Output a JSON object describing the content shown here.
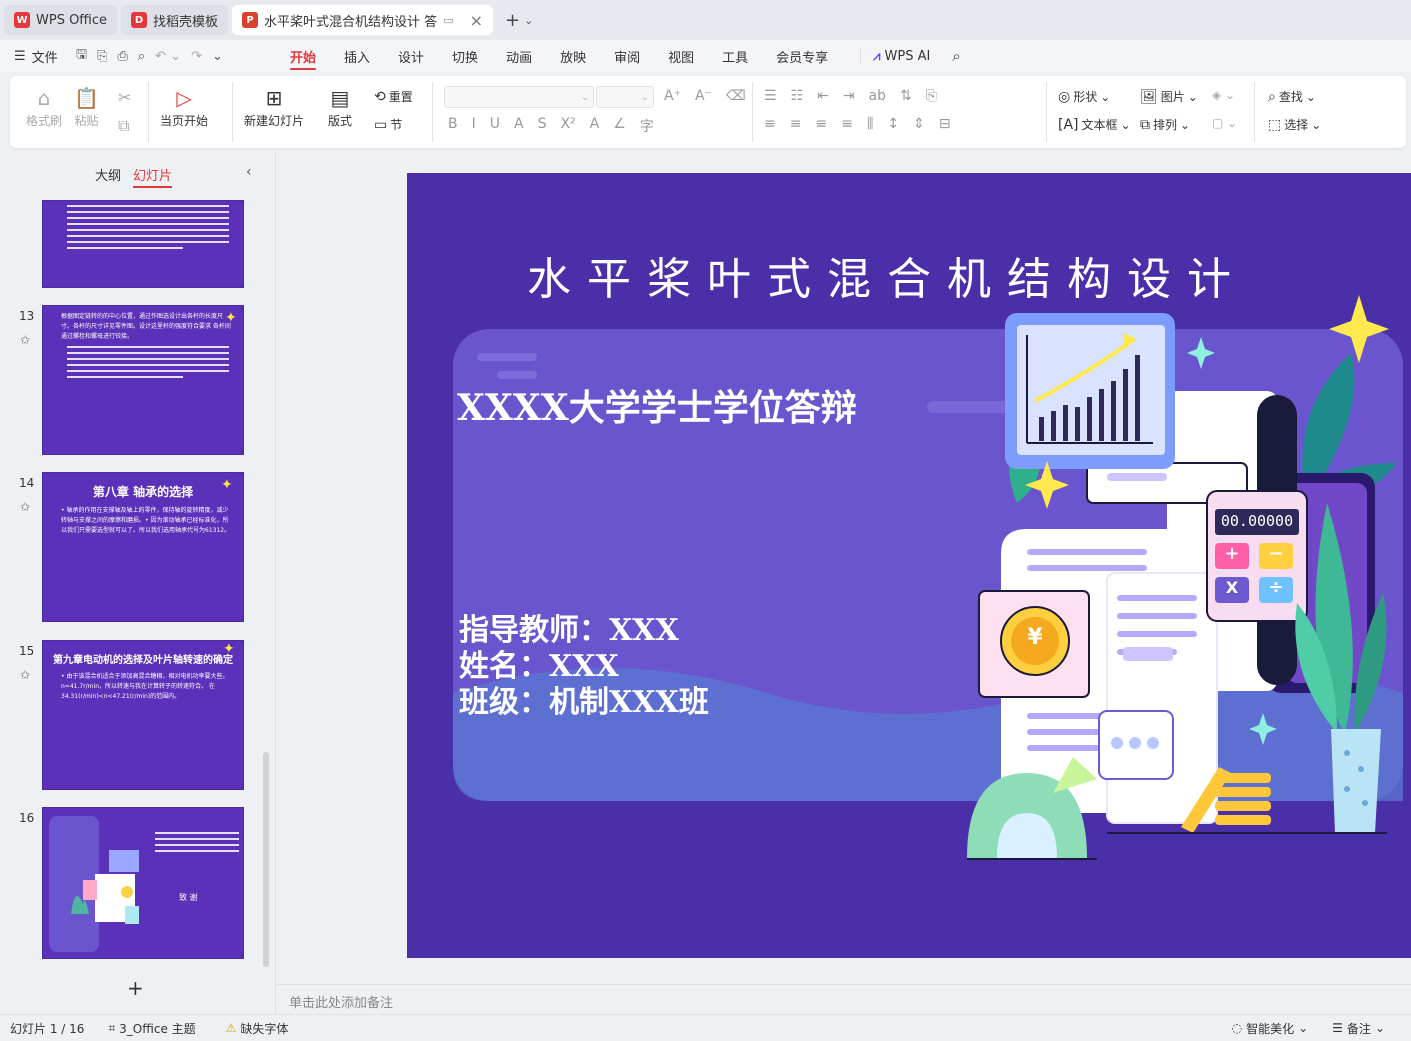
{
  "tabs": [
    {
      "label": "WPS Office",
      "logo": "W",
      "logo_color": "#e5383b",
      "active": false
    },
    {
      "label": "找稻壳模板",
      "logo": "D",
      "logo_color": "#e5383b",
      "active": false
    },
    {
      "label": "水平桨叶式混合机结构设计 答",
      "logo": "P",
      "logo_color": "#d9402e",
      "active": true
    }
  ],
  "menu": {
    "file": "文件",
    "items": [
      "开始",
      "插入",
      "设计",
      "切换",
      "动画",
      "放映",
      "审阅",
      "视图",
      "工具",
      "会员专享"
    ],
    "active": "开始",
    "ai": "WPS AI"
  },
  "ribbon": {
    "format_painter": "格式刷",
    "paste": "粘贴",
    "play_from_current": "当页开始",
    "new_slide": "新建幻灯片",
    "layout": "版式",
    "reset": "重置",
    "section": "节",
    "shape": "形状",
    "picture": "图片",
    "textbox": "文本框",
    "arrange": "排列",
    "find": "查找",
    "select": "选择"
  },
  "left_panel": {
    "tab_outline": "大纲",
    "tab_slides": "幻灯片",
    "slides": [
      {
        "num": "13",
        "title": "",
        "body": "根据图定链转的的中心位置，通过作图选设计出各杆的长度尺寸。各杆的尺寸详见零件图。设计这里杆的强度符合要求 各杆间通过螺栓和螺母进行铰接。"
      },
      {
        "num": "14",
        "title": "第八章  轴承的选择",
        "body": "• 轴承的作用在支撑轴及轴上的零件，保持轴的旋转精度，减少转轴与支撑之间的摩擦和磨损。• 因为滚动轴承已经标准化，所以我们只需要选型就可以了。所以我们选用轴承代号为61312。"
      },
      {
        "num": "15",
        "title": "第九章电动机的选择及叶片轴转速的确定",
        "body": "• 由于该混合机适合于添加高混合糖稠，相对电机功率要大些。 n=41.7r/min，所以转速与我在计算转子的转速符合。 在34.31(r/min)<n<47.21(r/min)的范围内。"
      },
      {
        "num": "16",
        "title": "致 谢",
        "body": ""
      }
    ]
  },
  "slide": {
    "title": "水平桨叶式混合机结构设计",
    "subtitle": "XXXX大学学士学位答辩",
    "advisor": "指导教师：XXX",
    "name": "姓名：XXX",
    "class": "班级：机制XXX班",
    "calculator_display": "00.00000",
    "coin_symbol": "¥"
  },
  "notes_placeholder": "单击此处添加备注",
  "status": {
    "slide_counter": "幻灯片 1 / 16",
    "theme": "3_Office 主题",
    "missing_font": "缺失字体",
    "smart_beautify": "智能美化",
    "notes": "备注"
  },
  "colors": {
    "accent": "#e5383b",
    "slide_bg": "#4b2fa8",
    "slide_panel": "#6a55cf"
  }
}
